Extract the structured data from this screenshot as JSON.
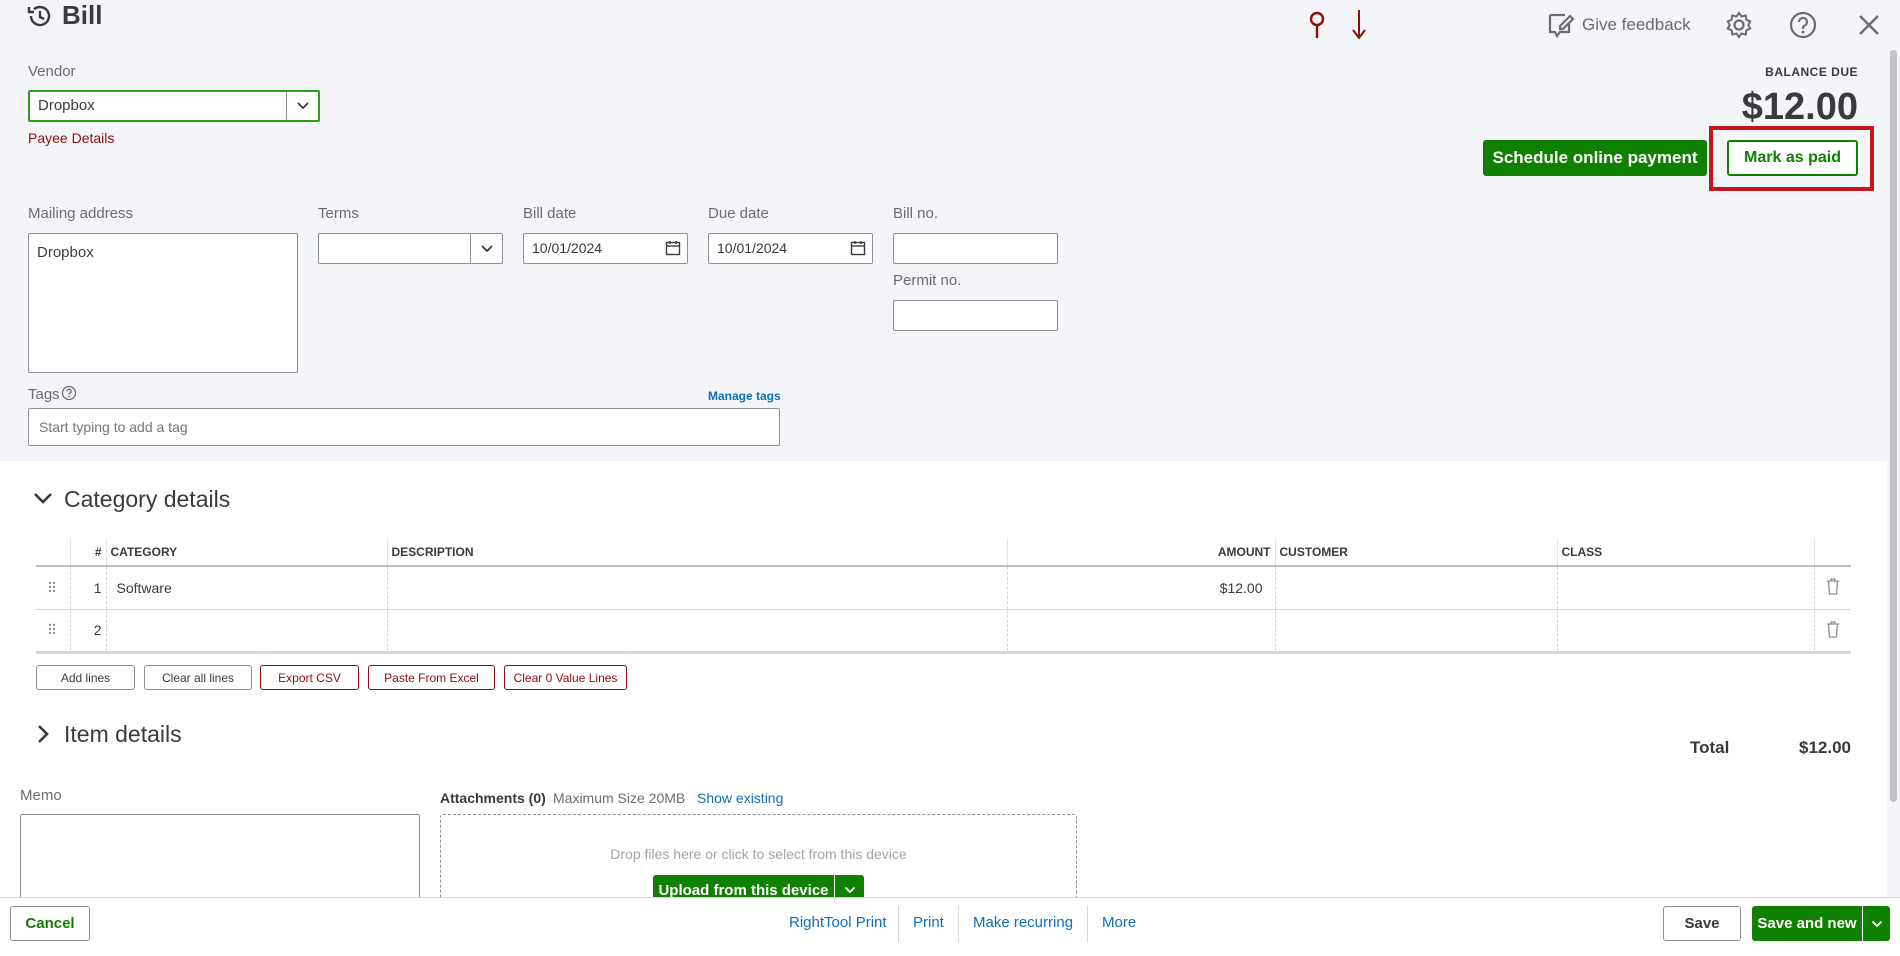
{
  "header": {
    "title": "Bill",
    "feedback": "Give feedback",
    "icons": [
      "history-icon",
      "pin-icon",
      "arrow-down-icon",
      "feedback-icon",
      "gear-icon",
      "help-icon",
      "close-icon"
    ]
  },
  "vendor": {
    "label": "Vendor",
    "value": "Dropbox",
    "payee_link": "Payee Details"
  },
  "balance": {
    "label": "BALANCE DUE",
    "amount": "$12.00"
  },
  "actions": {
    "schedule": "Schedule online payment",
    "mark_paid": "Mark as paid"
  },
  "mailing": {
    "label": "Mailing address",
    "value": "Dropbox"
  },
  "terms": {
    "label": "Terms",
    "value": ""
  },
  "bill_date": {
    "label": "Bill date",
    "value": "10/01/2024"
  },
  "due_date": {
    "label": "Due date",
    "value": "10/01/2024"
  },
  "bill_no": {
    "label": "Bill no.",
    "value": ""
  },
  "permit_no": {
    "label": "Permit no.",
    "value": ""
  },
  "tags": {
    "label": "Tags",
    "manage": "Manage tags",
    "placeholder": "Start typing to add a tag"
  },
  "category": {
    "title": "Category details",
    "columns": [
      "#",
      "CATEGORY",
      "DESCRIPTION",
      "AMOUNT",
      "CUSTOMER",
      "CLASS"
    ],
    "rows": [
      {
        "num": "1",
        "category": "Software",
        "description": "",
        "amount": "$12.00",
        "customer": "",
        "class": ""
      },
      {
        "num": "2",
        "category": "",
        "description": "",
        "amount": "",
        "customer": "",
        "class": ""
      }
    ],
    "buttons": [
      "Add lines",
      "Clear all lines",
      "Export CSV",
      "Paste From Excel",
      "Clear 0 Value Lines"
    ]
  },
  "item": {
    "title": "Item details"
  },
  "total": {
    "label": "Total",
    "value": "$12.00"
  },
  "memo": {
    "label": "Memo"
  },
  "attachments": {
    "label": "Attachments (0)",
    "max": "Maximum Size 20MB",
    "show": "Show existing",
    "drop": "Drop files here or click to select from this device",
    "upload": "Upload from this device"
  },
  "footer": {
    "cancel": "Cancel",
    "links": [
      "RightTool Print",
      "Print",
      "Make recurring",
      "More"
    ],
    "save": "Save",
    "save_new": "Save and new"
  },
  "colors": {
    "green": "#108000",
    "link": "#0d6fb5",
    "dark_red": "#8d0f0f",
    "highlight": "#c4161c"
  }
}
